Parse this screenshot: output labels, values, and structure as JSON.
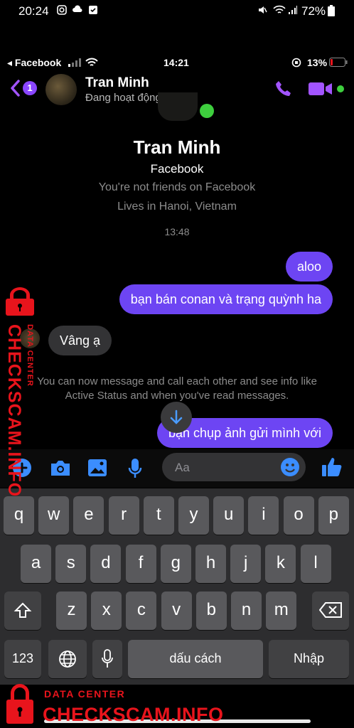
{
  "android_status": {
    "time": "20:24",
    "battery": "72%"
  },
  "ios_status": {
    "carrier": "◂ Facebook",
    "time": "14:21",
    "battery": "13%"
  },
  "header": {
    "unread_count": "1",
    "contact_name": "Tran Minh",
    "status": "Đang hoạt động"
  },
  "profile": {
    "name": "Tran Minh",
    "source": "Facebook",
    "friend_note": "You're not friends on Facebook",
    "location": "Lives in Hanoi, Vietnam"
  },
  "timestamp": "13:48",
  "messages": [
    {
      "from": "me",
      "text": "aloo"
    },
    {
      "from": "me",
      "text": "bạn bán conan và trạng quỳnh ha"
    },
    {
      "from": "them",
      "text": "Vâng ạ"
    }
  ],
  "system_message": {
    "line1": "You can now message and call each other and see info like",
    "line2": "Active Status and when you've read messages."
  },
  "last_message": {
    "from": "me",
    "text": "bạn chụp ảnh gửi mình với"
  },
  "composer": {
    "placeholder": "Aa"
  },
  "keyboard": {
    "row1": [
      "q",
      "w",
      "e",
      "r",
      "t",
      "y",
      "u",
      "i",
      "o",
      "p"
    ],
    "row2": [
      "a",
      "s",
      "d",
      "f",
      "g",
      "h",
      "j",
      "k",
      "l"
    ],
    "row3": [
      "z",
      "x",
      "c",
      "v",
      "b",
      "n",
      "m"
    ],
    "numbers_key": "123",
    "space_key": "dấu cách",
    "return_key": "Nhập"
  },
  "watermark": {
    "brand": "CHECKSCAM.INFO",
    "tag": "DATA CENTER"
  },
  "colors": {
    "accent": "#a254ff",
    "bubble": "#6d45f3",
    "watermark": "#e8141c"
  }
}
